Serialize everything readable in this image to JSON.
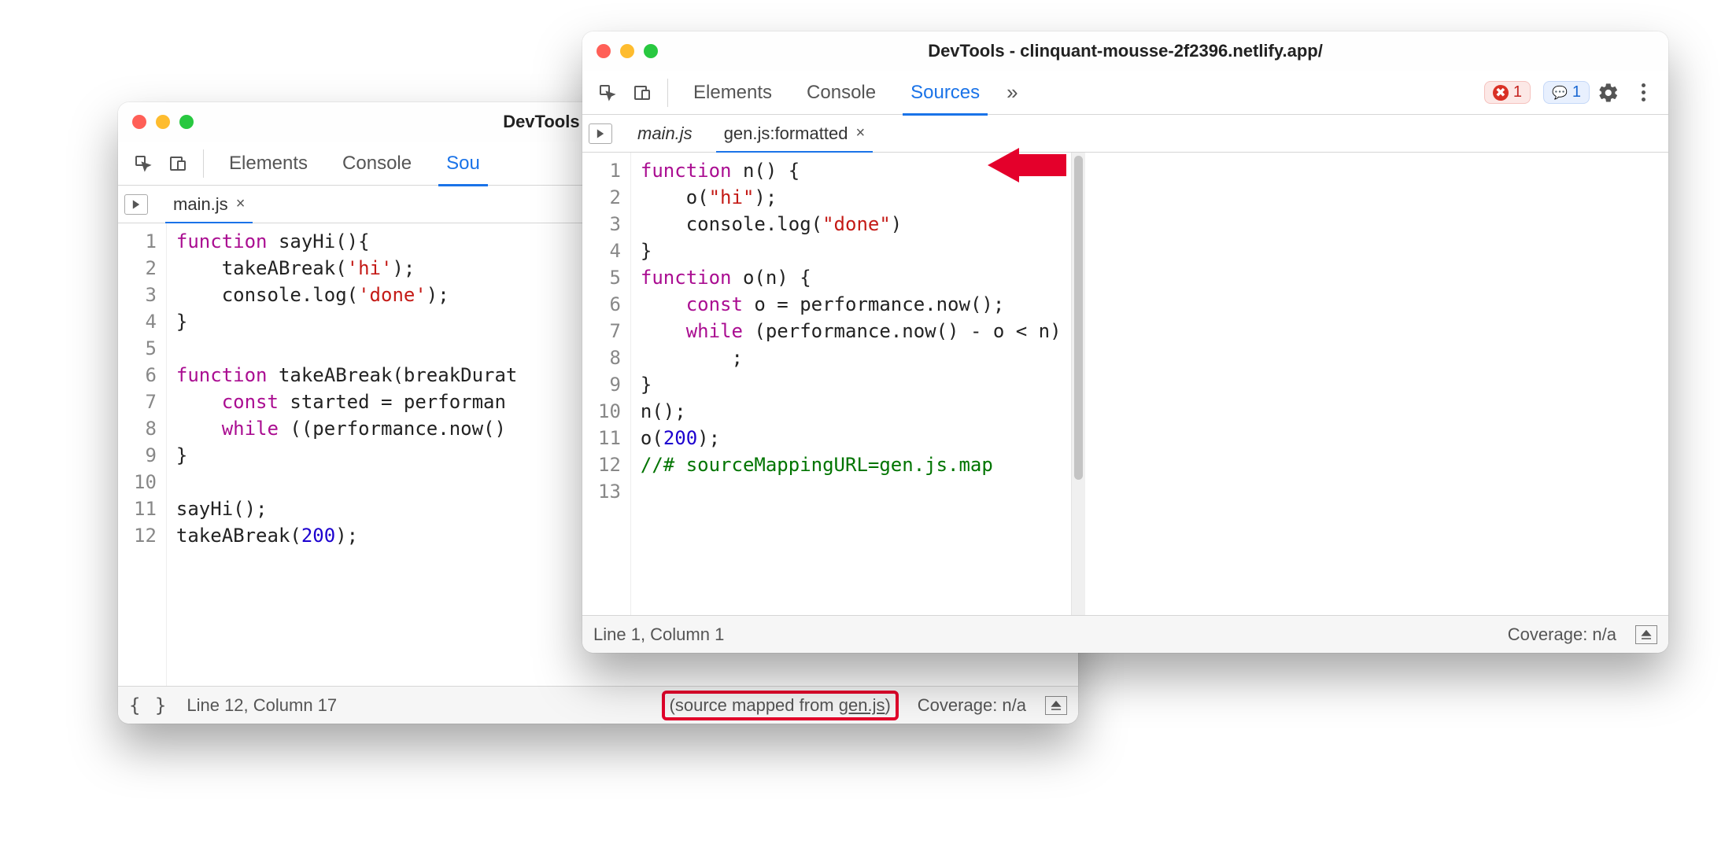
{
  "back_window": {
    "title": "DevTools - clinquant-m",
    "toolbar_tabs": [
      "Elements",
      "Console",
      "Sources"
    ],
    "toolbar_active": 2,
    "file_tabs": [
      {
        "label": "main.js",
        "active": true
      }
    ],
    "gutter": "1\n2\n3\n4\n5\n6\n7\n8\n9\n10\n11\n12",
    "status_cursor": "Line 12, Column 17",
    "status_mapped_prefix": "(source mapped from ",
    "status_mapped_link": "gen.js",
    "status_mapped_suffix": ")",
    "status_coverage": "Coverage: n/a"
  },
  "front_window": {
    "title": "DevTools - clinquant-mousse-2f2396.netlify.app/",
    "toolbar_tabs": [
      "Elements",
      "Console",
      "Sources"
    ],
    "toolbar_active": 2,
    "badge_err": "1",
    "badge_info": "1",
    "file_tabs": [
      {
        "label": "main.js",
        "active": false
      },
      {
        "label": "gen.js:formatted",
        "active": true
      }
    ],
    "gutter": "1\n2\n3\n4\n5\n6\n7\n8\n9\n10\n11\n12\n13",
    "status_cursor": "Line 1, Column 1",
    "status_coverage": "Coverage: n/a"
  },
  "chevron_label": "»"
}
